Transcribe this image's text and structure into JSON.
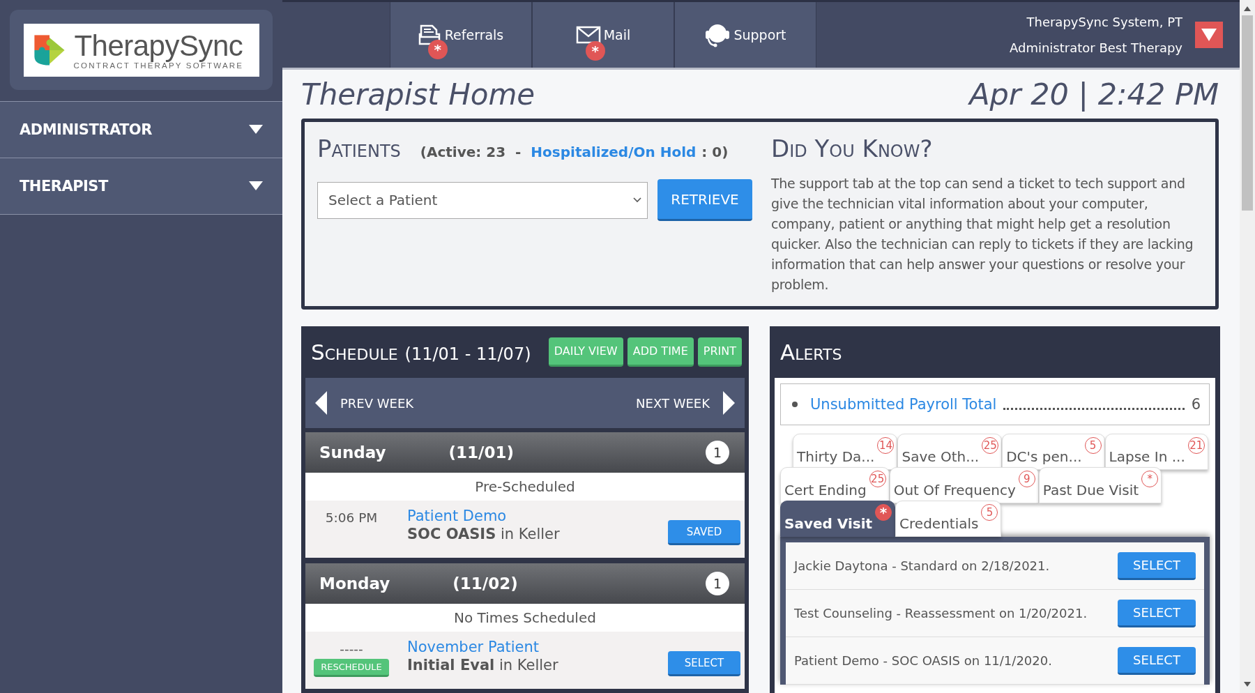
{
  "logo": {
    "name": "TherapySync",
    "tagline": "CONTRACT THERAPY SOFTWARE"
  },
  "sidebar": {
    "items": [
      {
        "label": "ADMINISTRATOR"
      },
      {
        "label": "THERAPIST"
      }
    ]
  },
  "nav": {
    "tabs": [
      {
        "label": "Referrals",
        "kind": "referrals",
        "badge": "*"
      },
      {
        "label": "Mail",
        "kind": "mail",
        "badge": "*"
      },
      {
        "label": "Support",
        "kind": "support"
      }
    ]
  },
  "user": {
    "name": "TherapySync System, PT",
    "role": "Administrator Best Therapy"
  },
  "page": {
    "title": "Therapist Home",
    "datetime": "Apr 20 | 2:42 PM"
  },
  "patients": {
    "title": "Patients",
    "active": "(Active: 23  -",
    "hospitalized_link": "Hospitalized/On Hold",
    "hospitalized_count": ": 0)",
    "select": {
      "placeholder": "Select a Patient"
    },
    "button": "RETRIEVE"
  },
  "did_you_know": {
    "title": "Did You Know?",
    "text": "The support tab at the top can send a ticket to tech support and give the technician vital information about your computer, company, patient or anything that might help get a resolution quicker. Also the technician can reply to tickets if they are lacking information that can help answer your questions or resolve your problem."
  },
  "schedule": {
    "title": "Schedule",
    "range": "(11/01 - 11/07)",
    "buttons": [
      "DAILY VIEW",
      "ADD TIME",
      "PRINT"
    ],
    "prev": "PREV WEEK",
    "next": "NEXT WEEK",
    "days": [
      {
        "day": "Sunday",
        "date": "(11/01)",
        "count": "1",
        "status": "Pre-Scheduled",
        "entries": [
          {
            "time": "5:06 PM",
            "patient": "Patient Demo",
            "visit": "**SOC OASIS** in Keller",
            "button": "SAVED"
          }
        ]
      },
      {
        "day": "Monday",
        "date": "(11/02)",
        "count": "1",
        "status": "No Times Scheduled",
        "entries": [
          {
            "time": "-----",
            "reschedule": "RESCHEDULE",
            "patient": "November Patient",
            "visit": "**Initial Eval** in Keller",
            "button": "SELECT"
          }
        ]
      }
    ]
  },
  "alerts": {
    "title": "Alerts",
    "summary": [
      {
        "label": "Unsubmitted Payroll Total",
        "count": "6"
      }
    ],
    "tab_rows": [
      [
        {
          "label": "Thirty Da...",
          "count": "14",
          "selected": false
        },
        {
          "label": "Save Oth...",
          "count": "25",
          "selected": false
        },
        {
          "label": "DC's pen...",
          "count": "5",
          "selected": false
        },
        {
          "label": "Lapse In ...",
          "count": "21",
          "selected": false
        }
      ],
      [
        {
          "label": "Cert Ending",
          "count": "25",
          "selected": false
        },
        {
          "label": "Out Of Frequency",
          "count": "9",
          "selected": false
        },
        {
          "label": "Past Due Visit",
          "count": "*",
          "selected": false
        }
      ],
      [
        {
          "label": "Saved Visit",
          "count": "*",
          "selected": true
        },
        {
          "label": "Credentials",
          "count": "5",
          "selected": false
        }
      ]
    ],
    "items": [
      {
        "text": "Jackie Daytona - Standard on 2/18/2021.",
        "button": "SELECT"
      },
      {
        "text": "Test Counseling - Reassessment on 1/20/2021.",
        "button": "SELECT"
      },
      {
        "text": "Patient Demo - SOC OASIS on 11/1/2020.",
        "button": "SELECT"
      }
    ]
  }
}
